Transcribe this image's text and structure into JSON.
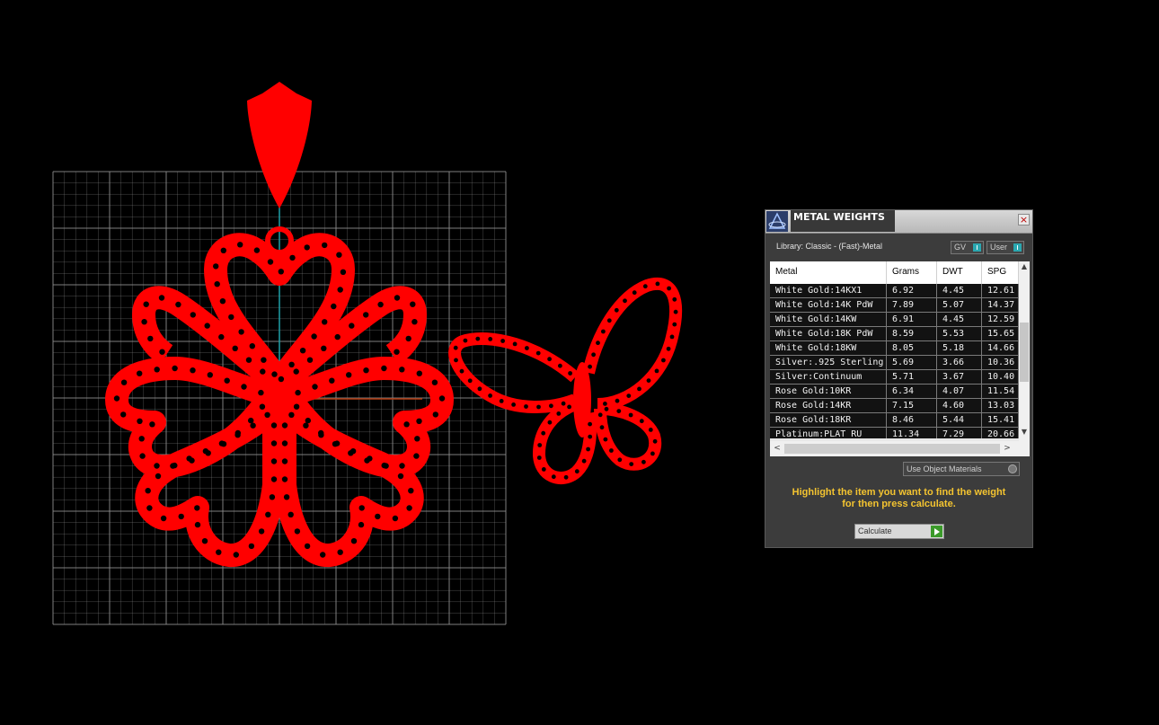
{
  "dialog": {
    "title": "METAL WEIGHTS",
    "close": "×",
    "library": "Library: Classic - (Fast)-Metal",
    "toggle_gv": "GV",
    "toggle_user": "User",
    "columns": [
      "Metal",
      "Grams",
      "DWT",
      "SPG"
    ],
    "rows": [
      [
        "White Gold:14KX1",
        "6.92",
        "4.45",
        "12.61"
      ],
      [
        "White Gold:14K PdW",
        "7.89",
        "5.07",
        "14.37"
      ],
      [
        "White Gold:14KW",
        "6.91",
        "4.45",
        "12.59"
      ],
      [
        "White Gold:18K PdW",
        "8.59",
        "5.53",
        "15.65"
      ],
      [
        "White Gold:18KW",
        "8.05",
        "5.18",
        "14.66"
      ],
      [
        "Silver:.925 Sterling",
        "5.69",
        "3.66",
        "10.36"
      ],
      [
        "Silver:Continuum",
        "5.71",
        "3.67",
        "10.40"
      ],
      [
        "Rose Gold:10KR",
        "6.34",
        "4.07",
        "11.54"
      ],
      [
        "Rose Gold:14KR",
        "7.15",
        "4.60",
        "13.03"
      ],
      [
        "Rose Gold:18KR",
        "8.46",
        "5.44",
        "15.41"
      ],
      [
        "Platinum:PLAT RU",
        "11.34",
        "7.29",
        "20.66"
      ]
    ],
    "use_object_materials": "Use Object Materials",
    "instructions_line1": "Highlight the item you want to find the weight",
    "instructions_line2": "for then press calculate.",
    "calculate": "Calculate",
    "scroll_up": "▲",
    "scroll_down": "▼",
    "scroll_left": "<",
    "scroll_right": ">"
  },
  "colors": {
    "background": "#000000",
    "grid": "#8c8c8c",
    "model": "#ff0000",
    "axis_y": "#1fa0a8",
    "axis_x": "#b03a10",
    "instructions": "#f4c430"
  }
}
